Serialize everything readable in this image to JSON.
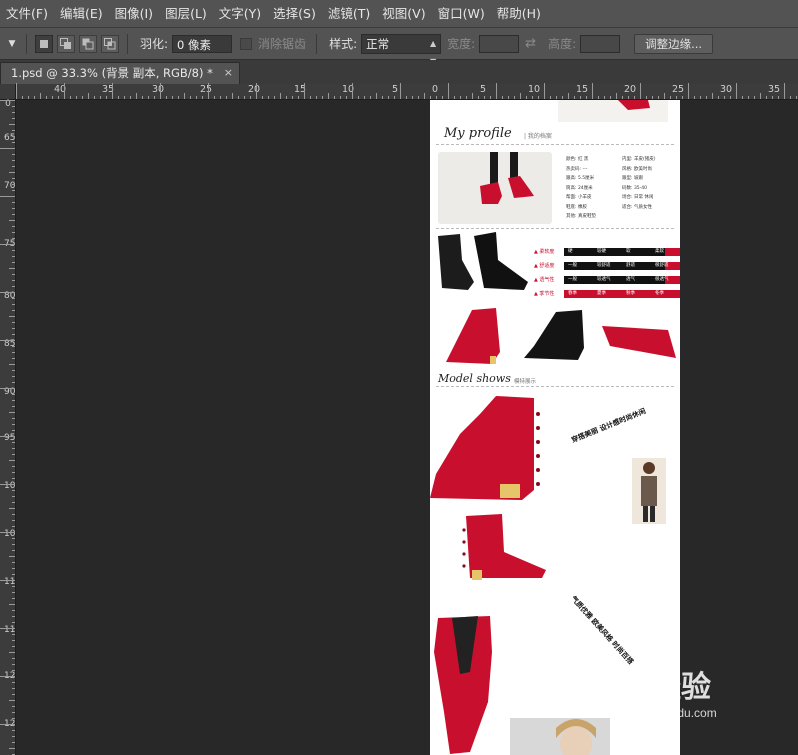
{
  "menubar": {
    "items": [
      "文件(F)",
      "编辑(E)",
      "图像(I)",
      "图层(L)",
      "文字(Y)",
      "选择(S)",
      "滤镜(T)",
      "视图(V)",
      "窗口(W)",
      "帮助(H)"
    ]
  },
  "options": {
    "feather_label": "羽化:",
    "feather_value": "0 像素",
    "antialias_label": "消除锯齿",
    "style_label": "样式:",
    "style_value": "正常",
    "width_label": "宽度:",
    "height_label": "高度:",
    "refine_edge_button": "调整边缘..."
  },
  "document_tab": {
    "title": "1.psd @ 33.3% (背景 副本, RGB/8) *",
    "close": "×"
  },
  "rulers": {
    "horizontal_labels": [
      "40",
      "35",
      "30",
      "25",
      "20",
      "15",
      "10",
      "5",
      "0",
      "5",
      "10",
      "15",
      "20",
      "25",
      "30",
      "35"
    ],
    "vertical_labels": [
      "0",
      "65",
      "70",
      "75",
      "80",
      "85",
      "90",
      "95",
      "100",
      "105",
      "110",
      "115",
      "120",
      "125"
    ]
  },
  "document": {
    "profile_title": "My profile",
    "profile_subtitle": "| 我的档案",
    "models_title": "Model shows",
    "models_subtitle": "模特展示",
    "specs": [
      "颜色: 红 黑",
      "热卖码: ---",
      "跟高: 5.5厘米",
      "筒高: 24厘米",
      "帮面: 小羊皮",
      "鞋底: 橡胶",
      "其他: 真皮鞋垫",
      "内里: 羊皮(猪皮)",
      "风格: 欧美时尚",
      "跟型: 坡跟",
      "码数: 35-40",
      "场合: 日常 休闲",
      "适合: 气质女性"
    ],
    "ratings": [
      {
        "label": "▲ 柔软度",
        "cells": [
          "硬",
          "较硬",
          "软",
          "柔软"
        ]
      },
      {
        "label": "▲ 舒适度",
        "cells": [
          "一般",
          "较舒适",
          "舒适",
          "很舒适"
        ]
      },
      {
        "label": "▲ 透气性",
        "cells": [
          "一般",
          "较透气",
          "透气",
          "很透气"
        ]
      },
      {
        "label": "▲ 季节性",
        "cells": [
          "春季",
          "夏季",
          "秋季",
          "冬季"
        ]
      }
    ],
    "promo_text_1": "穿搭美丽 设计感时尚休闲",
    "promo_text_2": "气质优雅 欧美风格 时尚百搭"
  },
  "watermark": {
    "text": "Bai  经验",
    "sub": "jingyan.baidu.com"
  },
  "colors": {
    "accent_red": "#c8102e",
    "ui_panel": "#535353",
    "canvas_bg": "#282828"
  }
}
